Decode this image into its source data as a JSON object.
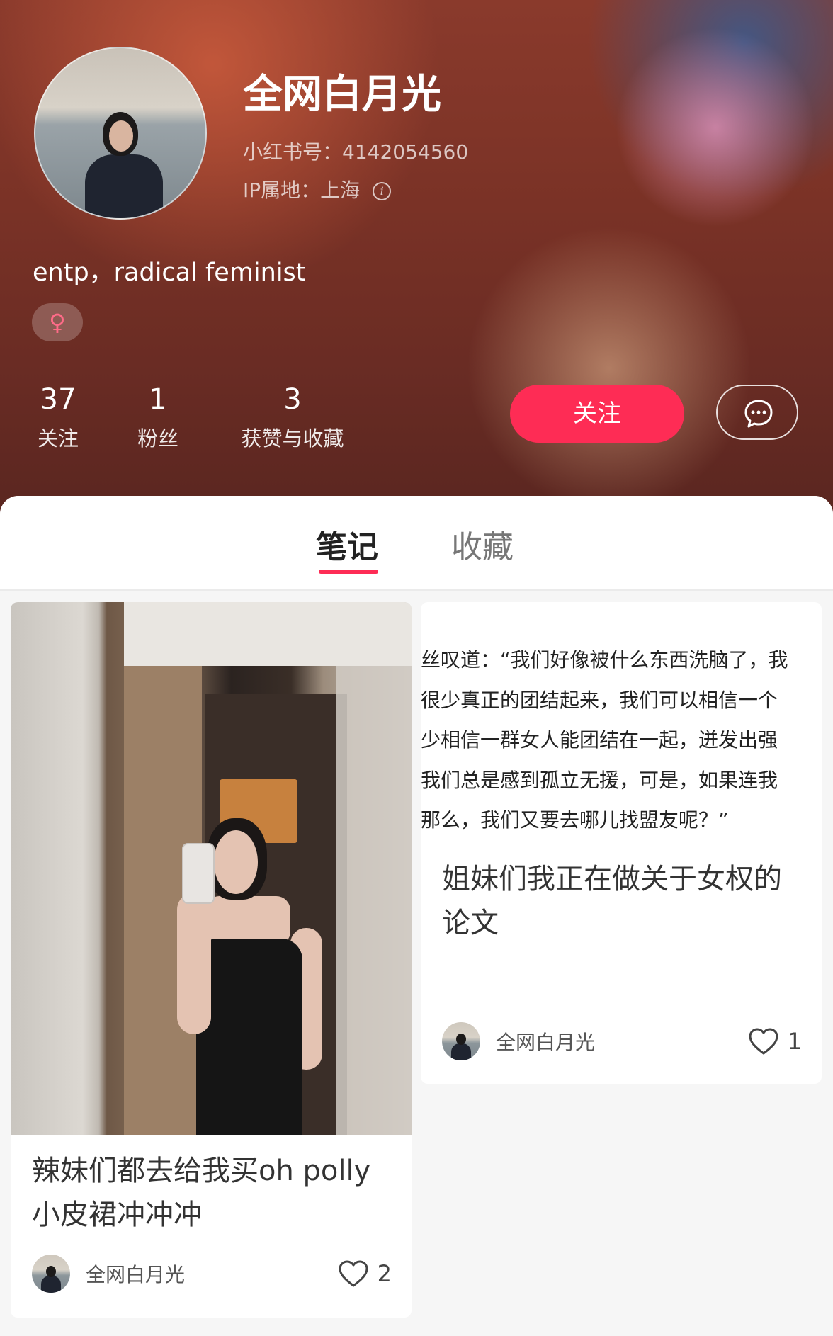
{
  "profile": {
    "username": "全网白月光",
    "redbook_id": "小红书号：4142054560",
    "ip_location": "IP属地：上海",
    "bio": "entp，radical feminist",
    "gender_symbol": "♀",
    "stats": [
      {
        "value": "37",
        "label": "关注"
      },
      {
        "value": "1",
        "label": "粉丝"
      },
      {
        "value": "3",
        "label": "获赞与收藏"
      }
    ],
    "follow_label": "关注",
    "accent_color": "#fe2c55"
  },
  "tabs": {
    "notes": "笔记",
    "collections": "收藏",
    "active": "笔记"
  },
  "notes": [
    {
      "title": "辣妹们都去给我买oh polly小皮裙冲冲冲",
      "author": "全网白月光",
      "likes": "2"
    },
    {
      "quote_lines": [
        "丝叹道：“我们好像被什么东西洗脑了，我",
        "很少真正的团结起来，我们可以相信一个",
        "少相信一群女人能团结在一起，迸发出强",
        "我们总是感到孤立无援，可是，如果连我",
        "那么，我们又要去哪儿找盟友呢？”"
      ],
      "title": "姐妹们我正在做关于女权的论文",
      "author": "全网白月光",
      "likes": "1"
    }
  ]
}
